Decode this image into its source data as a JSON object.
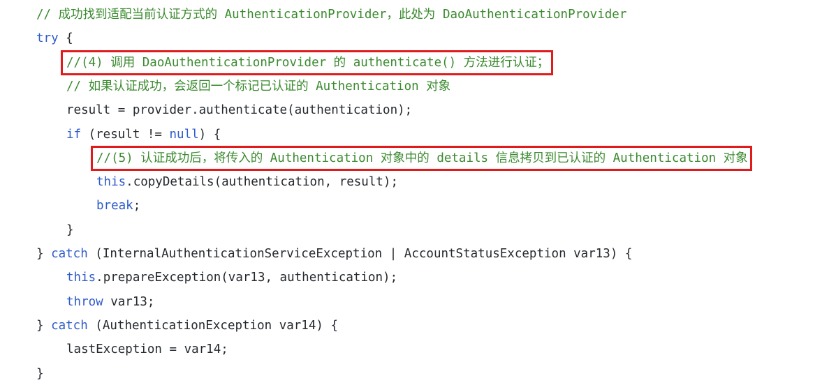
{
  "code": {
    "lines": [
      {
        "indent": 0,
        "tokens": [
          {
            "t": "cm",
            "v": "// 成功找到适配当前认证方式的 AuthenticationProvider，此处为 DaoAuthenticationProvider"
          }
        ]
      },
      {
        "indent": 0,
        "tokens": [
          {
            "t": "kw",
            "v": "try"
          },
          {
            "t": "pl",
            "v": " {"
          }
        ]
      },
      {
        "indent": 1,
        "tokens": [
          {
            "t": "cm",
            "v": "//(4) 调用 DaoAuthenticationProvider 的 authenticate() 方法进行认证；"
          }
        ]
      },
      {
        "indent": 1,
        "tokens": [
          {
            "t": "cm",
            "v": "// 如果认证成功，会返回一个标记已认证的 Authentication 对象"
          }
        ]
      },
      {
        "indent": 1,
        "tokens": [
          {
            "t": "pl",
            "v": "result = provider.authenticate(authentication);"
          }
        ]
      },
      {
        "indent": 1,
        "tokens": [
          {
            "t": "kw",
            "v": "if"
          },
          {
            "t": "pl",
            "v": " (result != "
          },
          {
            "t": "kw",
            "v": "null"
          },
          {
            "t": "pl",
            "v": ") {"
          }
        ]
      },
      {
        "indent": 2,
        "tokens": [
          {
            "t": "cm",
            "v": "//(5) 认证成功后，将传入的 Authentication 对象中的 details 信息拷贝到已认证的 Authentication 对象"
          }
        ]
      },
      {
        "indent": 2,
        "tokens": [
          {
            "t": "kw",
            "v": "this"
          },
          {
            "t": "pl",
            "v": ".copyDetails(authentication, result);"
          }
        ]
      },
      {
        "indent": 2,
        "tokens": [
          {
            "t": "kw",
            "v": "break"
          },
          {
            "t": "pl",
            "v": ";"
          }
        ]
      },
      {
        "indent": 1,
        "tokens": [
          {
            "t": "pl",
            "v": "}"
          }
        ]
      },
      {
        "indent": 0,
        "tokens": [
          {
            "t": "pl",
            "v": "} "
          },
          {
            "t": "kw",
            "v": "catch"
          },
          {
            "t": "pl",
            "v": " (InternalAuthenticationServiceException | AccountStatusException var13) {"
          }
        ]
      },
      {
        "indent": 1,
        "tokens": [
          {
            "t": "kw",
            "v": "this"
          },
          {
            "t": "pl",
            "v": ".prepareException(var13, authentication);"
          }
        ]
      },
      {
        "indent": 1,
        "tokens": [
          {
            "t": "kw",
            "v": "throw"
          },
          {
            "t": "pl",
            "v": " var13;"
          }
        ]
      },
      {
        "indent": 0,
        "tokens": [
          {
            "t": "pl",
            "v": "} "
          },
          {
            "t": "kw",
            "v": "catch"
          },
          {
            "t": "pl",
            "v": " (AuthenticationException var14) {"
          }
        ]
      },
      {
        "indent": 1,
        "tokens": [
          {
            "t": "pl",
            "v": "lastException = var14;"
          }
        ]
      },
      {
        "indent": 0,
        "tokens": [
          {
            "t": "pl",
            "v": "}"
          }
        ]
      }
    ],
    "highlighted_lines": [
      2,
      6
    ],
    "colors": {
      "comment": "#3a8a2e",
      "keyword": "#2f5bc9",
      "plain": "#24292e",
      "highlight_border": "#e01b1b",
      "background": "#ffffff"
    }
  }
}
